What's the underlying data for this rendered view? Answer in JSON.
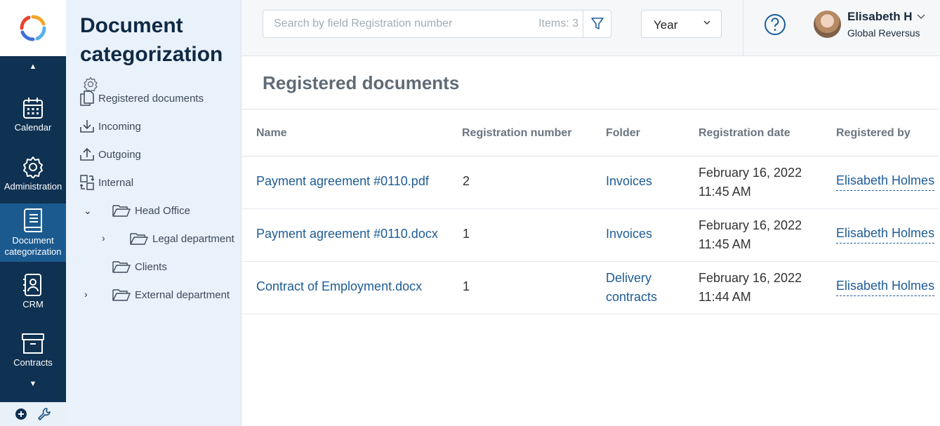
{
  "rail": {
    "items": [
      {
        "label": "Calendar",
        "icon": "calendar-icon"
      },
      {
        "label": "Administration",
        "icon": "gear-icon"
      },
      {
        "label": "Document categorization",
        "icon": "book-icon"
      },
      {
        "label": "CRM",
        "icon": "contact-icon"
      },
      {
        "label": "Contracts",
        "icon": "archive-icon"
      }
    ],
    "accent": "#1b5a8f",
    "background": "#0f3152"
  },
  "nav": {
    "title": "Document categorization",
    "items": [
      {
        "label": "Registered documents",
        "icon": "documents-icon"
      },
      {
        "label": "Incoming",
        "icon": "download-icon"
      },
      {
        "label": "Outgoing",
        "icon": "upload-icon"
      },
      {
        "label": "Internal",
        "icon": "swap-icon"
      }
    ],
    "folders": [
      {
        "label": "Head Office",
        "expanded": true
      },
      {
        "label": "Legal department",
        "expanded": false
      },
      {
        "label": "Clients"
      },
      {
        "label": "External department",
        "expanded": false
      }
    ]
  },
  "header": {
    "search_placeholder": "Search by field Registration number",
    "items_count": "Items: 3",
    "period": "Year",
    "user_name": "Elisabeth H",
    "user_org": "Global Reversus"
  },
  "main": {
    "title": "Registered documents",
    "columns": [
      "Name",
      "Registration number",
      "Folder",
      "Registration date",
      "Registered by"
    ],
    "rows": [
      {
        "name": "Payment agreement #0110.pdf",
        "number": "2",
        "folder": "Invoices",
        "folder2": "",
        "date": "February 16, 2022",
        "time": "11:45 AM",
        "by": "Elisabeth Holmes"
      },
      {
        "name": "Payment agreement #0110.docx",
        "number": "1",
        "folder": "Invoices",
        "folder2": "",
        "date": "February 16, 2022",
        "time": "11:45 AM",
        "by": "Elisabeth Holmes"
      },
      {
        "name": "Contract of Employment.docx",
        "number": "1",
        "folder": "Delivery",
        "folder2": "contracts",
        "date": "February 16, 2022",
        "time": "11:44 AM",
        "by": "Elisabeth Holmes"
      }
    ]
  }
}
